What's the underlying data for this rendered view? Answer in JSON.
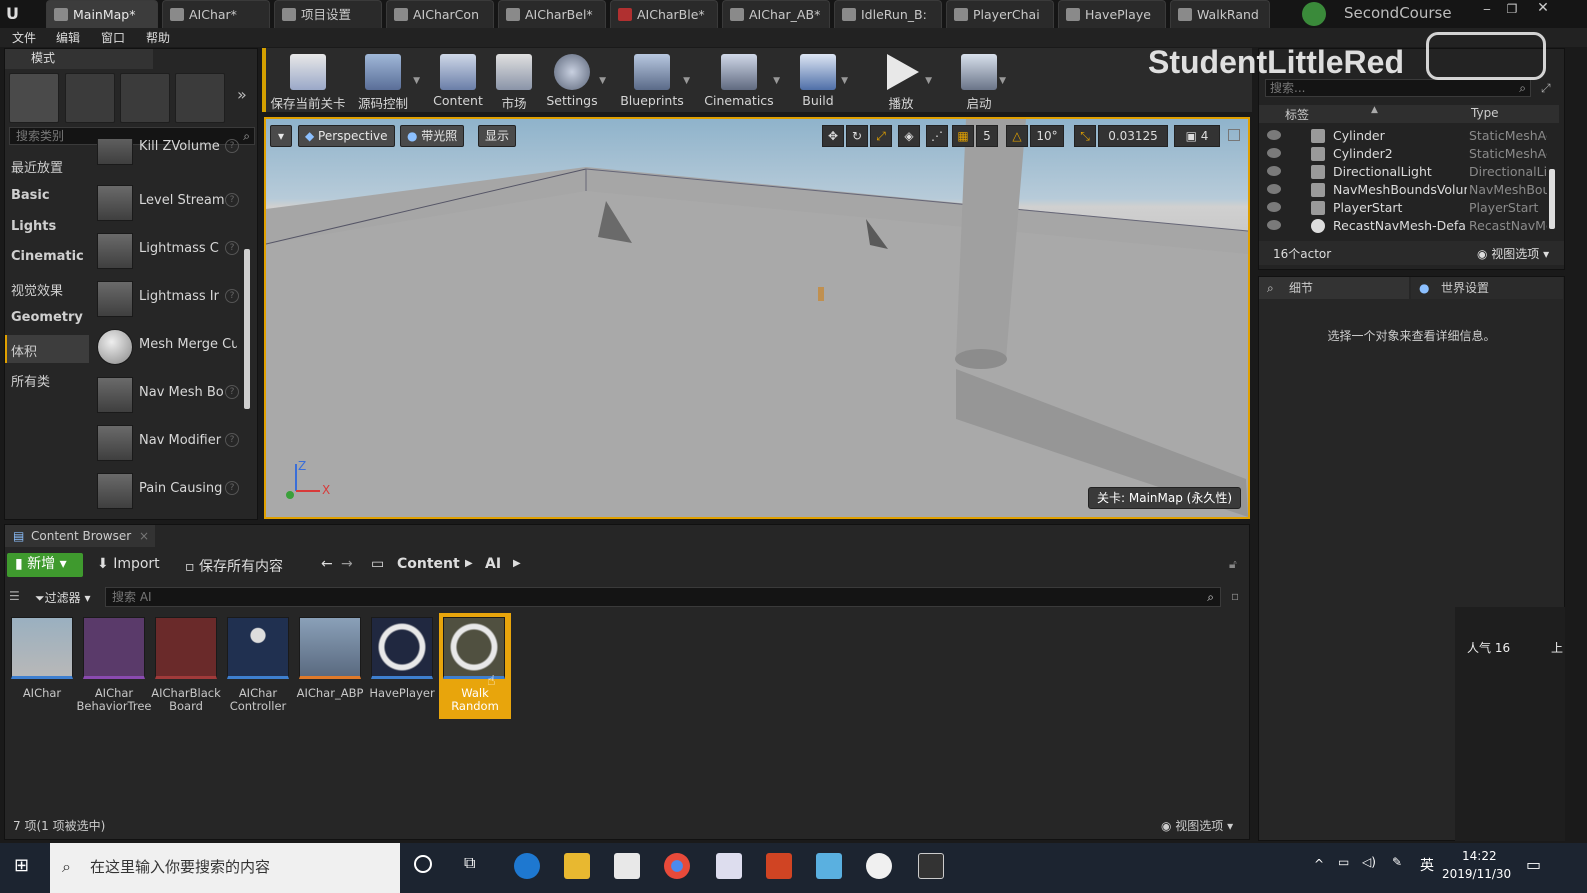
{
  "titlebar": {
    "tabs": [
      {
        "label": "MainMap*"
      },
      {
        "label": "AIChar*"
      },
      {
        "label": "项目设置"
      },
      {
        "label": "AICharCon"
      },
      {
        "label": "AICharBel*"
      },
      {
        "label": "AICharBle*"
      },
      {
        "label": "AIChar_AB*"
      },
      {
        "label": "IdleRun_B:"
      },
      {
        "label": "PlayerChai"
      },
      {
        "label": "HavePlaye"
      },
      {
        "label": "WalkRand"
      }
    ],
    "project": "SecondCourse",
    "watermark": "StudentLittleRed"
  },
  "menubar": {
    "items": [
      "文件",
      "编辑",
      "窗口",
      "帮助"
    ]
  },
  "modes": {
    "title": "模式",
    "search_placeholder": "搜索类别",
    "categories": [
      "最近放置",
      "Basic",
      "Lights",
      "Cinematic",
      "视觉效果",
      "Geometry",
      "体积",
      "所有类"
    ],
    "items": [
      "Kill ZVolume",
      "Level Stream",
      "Lightmass C",
      "Lightmass Ir",
      "Mesh Merge Cu",
      "Nav Mesh Bo",
      "Nav Modifier",
      "Pain Causing"
    ]
  },
  "toolbar": {
    "buttons": [
      "保存当前关卡",
      "源码控制",
      "Content",
      "市场",
      "Settings",
      "Blueprints",
      "Cinematics",
      "Build",
      "播放",
      "启动"
    ]
  },
  "viewport": {
    "perspective": "Perspective",
    "lit": "带光照",
    "show": "显示",
    "grid_snap": "5",
    "rot_snap": "10°",
    "scale_snap": "0.03125",
    "camera_speed": "4",
    "level_label": "关卡: MainMap (永久性)",
    "axis_z": "Z",
    "axis_x": "X"
  },
  "outliner": {
    "search_placeholder": "搜索...",
    "col_label": "标签",
    "col_type": "Type",
    "rows": [
      {
        "name": "Cylinder",
        "type": "StaticMeshAc"
      },
      {
        "name": "Cylinder2",
        "type": "StaticMeshAc"
      },
      {
        "name": "DirectionalLight",
        "type": "DirectionalLic"
      },
      {
        "name": "NavMeshBoundsVolum",
        "type": "NavMeshBou"
      },
      {
        "name": "PlayerStart",
        "type": "PlayerStart"
      },
      {
        "name": "RecastNavMesh-Defaul",
        "type": "RecastNavMe"
      }
    ],
    "count": "16个actor",
    "view_options": "视图选项"
  },
  "details": {
    "tab_details": "细节",
    "tab_world": "世界设置",
    "empty_msg": "选择一个对象来查看详细信息。",
    "popularity": "人气 16",
    "up": "上"
  },
  "content_browser": {
    "tab": "Content Browser",
    "new": "新增",
    "import": "Import",
    "save_all": "保存所有内容",
    "path": [
      "Content",
      "AI"
    ],
    "filter": "过滤器",
    "search_placeholder": "搜索 AI",
    "assets": [
      {
        "name": "AIChar"
      },
      {
        "name": "AIChar\nBehaviorTree"
      },
      {
        "name": "AICharBlack\nBoard"
      },
      {
        "name": "AIChar\nController"
      },
      {
        "name": "AIChar_ABP"
      },
      {
        "name": "HavePlayer"
      },
      {
        "name": "Walk\nRandom"
      }
    ],
    "status": "7 项(1 项被选中)",
    "view_options": "视图选项"
  },
  "taskbar": {
    "search": "在这里输入你要搜索的内容",
    "lang": "英",
    "time": "14:22",
    "date": "2019/11/30"
  },
  "colors": {
    "accent": "#e8a50c",
    "new_button": "#3f9a2e",
    "viewport_border": "#e0a000"
  }
}
